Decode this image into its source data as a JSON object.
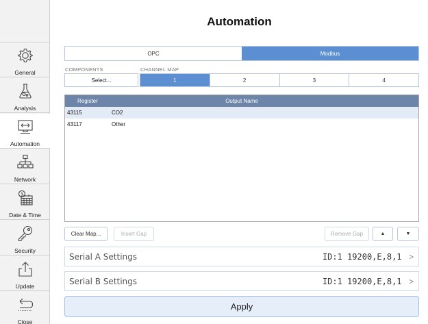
{
  "page": {
    "title": "Automation"
  },
  "sidebar": {
    "items": [
      {
        "label": "General",
        "icon": "gear-icon"
      },
      {
        "label": "Analysis",
        "icon": "flask-icon"
      },
      {
        "label": "Automation",
        "icon": "automation-icon"
      },
      {
        "label": "Network",
        "icon": "network-icon"
      },
      {
        "label": "Date & Time",
        "icon": "calendar-clock-icon"
      },
      {
        "label": "Security",
        "icon": "key-icon"
      },
      {
        "label": "Update",
        "icon": "upload-icon"
      },
      {
        "label": "Close",
        "icon": "back-arrow-icon"
      }
    ],
    "active": "Automation"
  },
  "protocol": {
    "tabs": [
      "OPC",
      "Modbus"
    ],
    "selected": "Modbus"
  },
  "components": {
    "label": "COMPONENTS",
    "button": "Select..."
  },
  "channel_map": {
    "label": "CHANNEL MAP",
    "tabs": [
      "1",
      "2",
      "3",
      "4"
    ],
    "selected": "1"
  },
  "table": {
    "headers": {
      "register": "Register",
      "output": "Output Name"
    },
    "rows": [
      {
        "register": "43115",
        "name": "CO2"
      },
      {
        "register": "43117",
        "name": "Other"
      }
    ]
  },
  "actions": {
    "clear_map": "Clear Map...",
    "insert_gap": "Insert Gap",
    "remove_gap": "Remove Gap",
    "move_up": "▲",
    "move_down": "▼"
  },
  "serial_a": {
    "label": "Serial A Settings",
    "value": "ID:1 19200,E,8,1",
    "chevron": ">"
  },
  "serial_b": {
    "label": "Serial B Settings",
    "value": "ID:1 19200,E,8,1",
    "chevron": ">"
  },
  "apply_label": "Apply",
  "colors": {
    "accent": "#5b8fd1",
    "table_header": "#6d85a8",
    "selected_row": "#e3ebf6"
  }
}
